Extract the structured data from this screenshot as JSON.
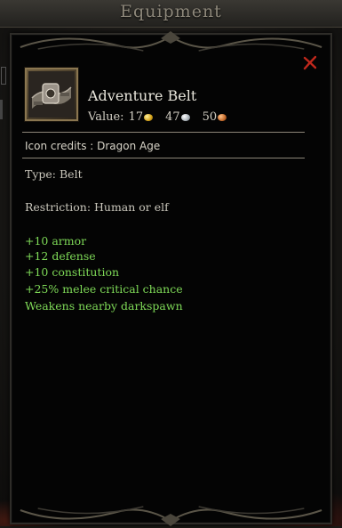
{
  "window": {
    "title": "Equipment"
  },
  "item": {
    "name": "Adventure Belt",
    "icon": "belt-icon",
    "value_label": "Value:",
    "value": {
      "gold": "17",
      "silver": "47",
      "copper": "50"
    },
    "credits": "Icon credits : Dragon Age",
    "type": "Type: Belt",
    "restriction": "Restriction: Human or elf",
    "bonuses": [
      "+10 armor",
      "+12 defense",
      "+10 constitution",
      "+25% melee critical chance",
      "Weakens nearby darkspawn"
    ]
  },
  "colors": {
    "bonus_text": "#7ed957",
    "close_icon": "#c0281c",
    "frame": "#8a7650"
  }
}
